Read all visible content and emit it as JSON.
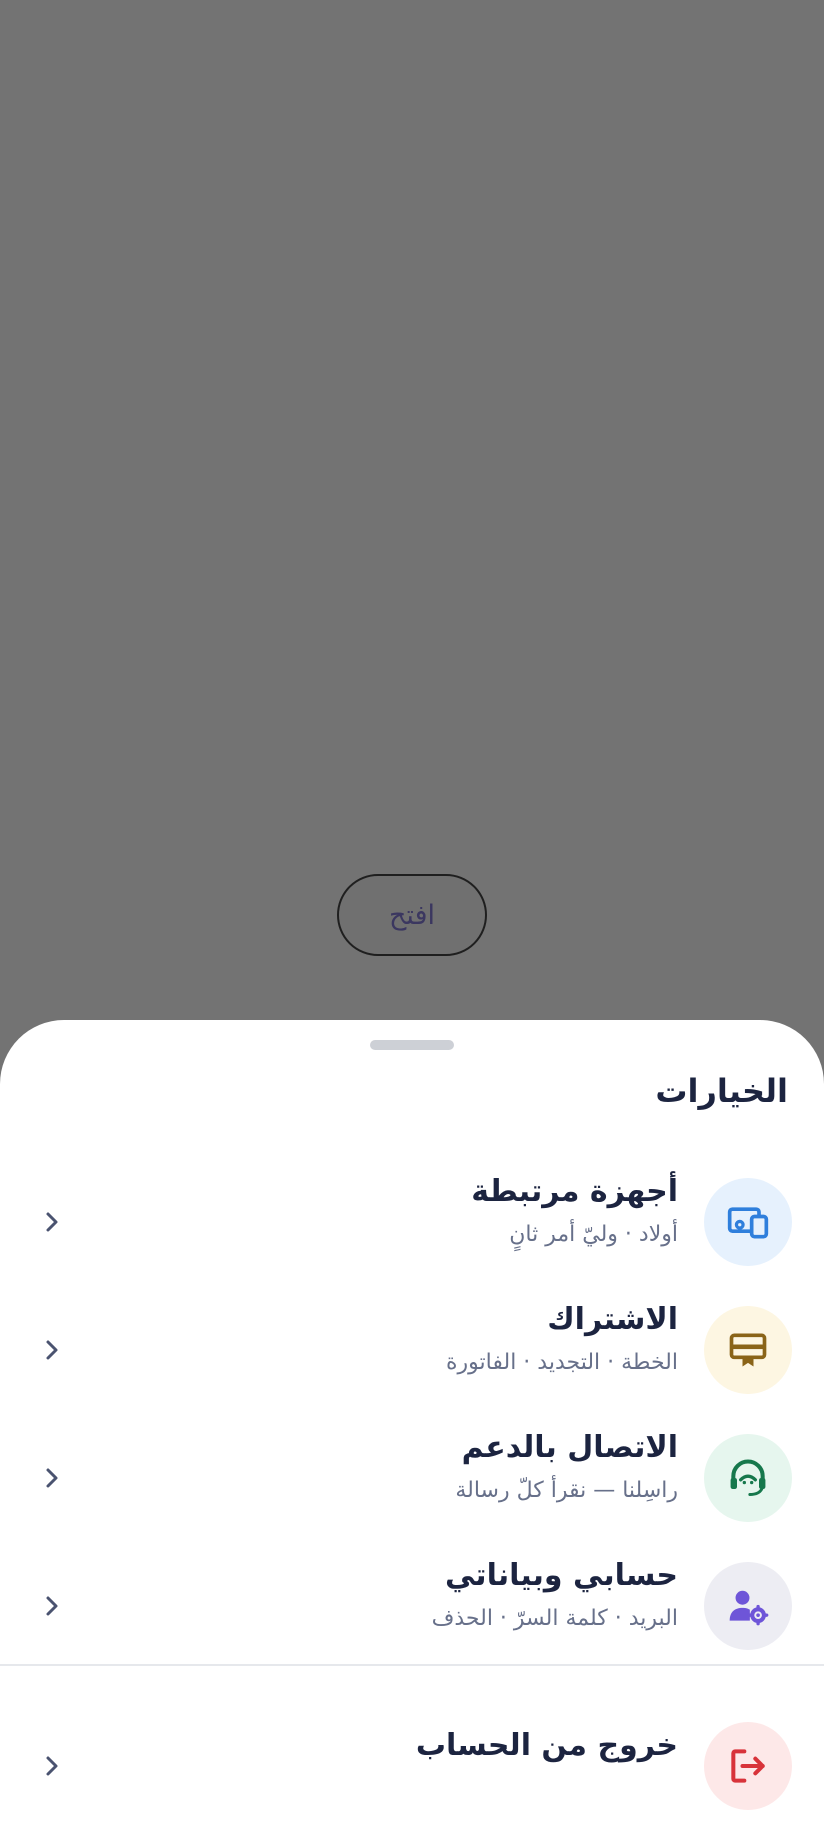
{
  "background": {
    "open_button_label": "افتح"
  },
  "sheet": {
    "title": "الخيارات",
    "items": [
      {
        "title": "أجهزة مرتبطة",
        "subtitle": "أولاد · وليّ أمر ثانٍ",
        "icon": "devices-icon",
        "icon_color": "#2f7fdc",
        "icon_bg": "#e6f1fd"
      },
      {
        "title": "الاشتراك",
        "subtitle": "الخطة · التجديد · الفاتورة",
        "icon": "subscription-card-icon",
        "icon_color": "#8a6418",
        "icon_bg": "#fdf6e2"
      },
      {
        "title": "الاتصال بالدعم",
        "subtitle": "راسِلنا — نقرأ كلّ رسالة",
        "icon": "support-agent-icon",
        "icon_color": "#16784c",
        "icon_bg": "#e6f6ee"
      },
      {
        "title": "حسابي وبياناتي",
        "subtitle": "البريد · كلمة السرّ · الحذف",
        "icon": "manage-account-icon",
        "icon_color": "#6e55d8",
        "icon_bg": "#ededf3"
      }
    ],
    "logout": {
      "title": "خروج من الحساب",
      "icon": "logout-icon",
      "icon_color": "#d8333a",
      "icon_bg": "#fde8e8"
    }
  },
  "colors": {
    "scrim": "#737373",
    "text_primary": "#1c2440",
    "text_secondary": "#67708a",
    "chevron": "#4a5370"
  }
}
